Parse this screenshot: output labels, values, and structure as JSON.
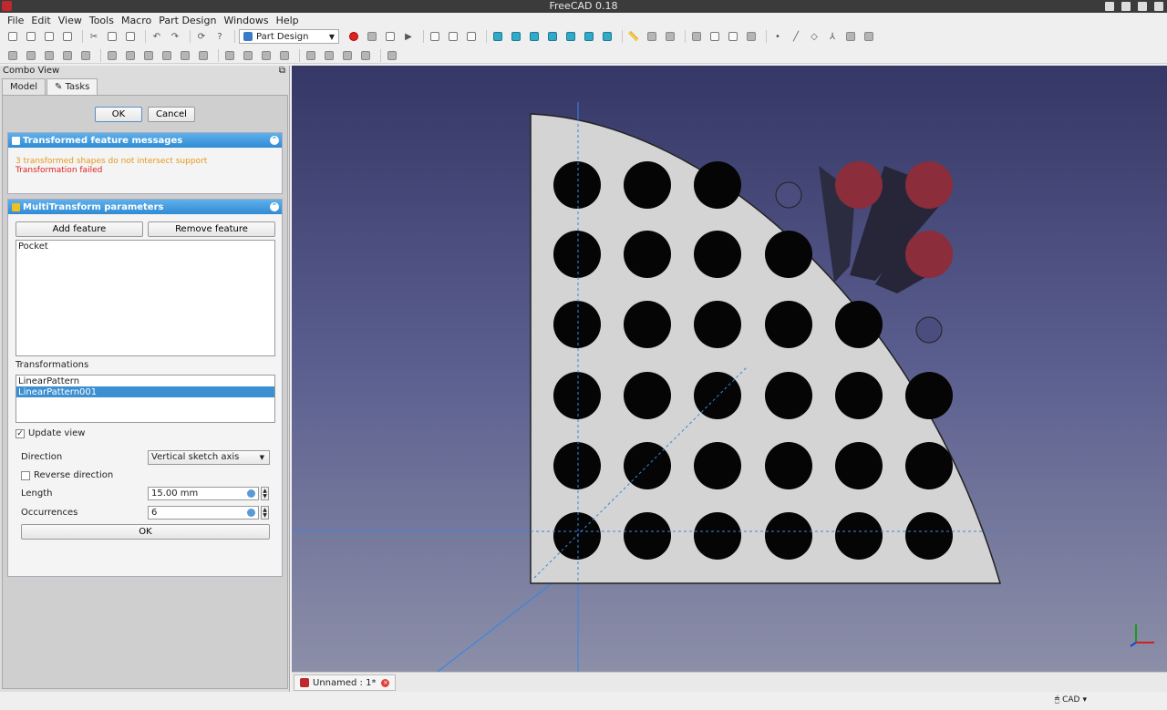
{
  "window": {
    "title": "FreeCAD 0.18"
  },
  "menu": [
    "File",
    "Edit",
    "View",
    "Tools",
    "Macro",
    "Part Design",
    "Windows",
    "Help"
  ],
  "toolbar": {
    "workbench": "Part Design"
  },
  "combo_view": {
    "title": "Combo View",
    "tabs": [
      "Model",
      "Tasks"
    ],
    "ok_label": "OK",
    "cancel_label": "Cancel"
  },
  "messages_panel": {
    "title": "Transformed feature messages",
    "warning": "3 transformed shapes do not intersect support",
    "error": "Transformation failed"
  },
  "multitransform_panel": {
    "title": "MultiTransform parameters",
    "add_feature": "Add feature",
    "remove_feature": "Remove feature",
    "features": [
      "Pocket"
    ],
    "transformations_label": "Transformations",
    "transformations": [
      "LinearPattern",
      "LinearPattern001"
    ],
    "selected_transformation": "LinearPattern001",
    "update_view_label": "Update view",
    "update_view_checked": true,
    "direction_label": "Direction",
    "direction_value": "Vertical sketch axis",
    "reverse_label": "Reverse direction",
    "reverse_checked": false,
    "length_label": "Length",
    "length_value": "15.00 mm",
    "occurrences_label": "Occurrences",
    "occurrences_value": "6",
    "ok_label": "OK"
  },
  "document_tab": {
    "label": "Unnamed : 1*"
  },
  "status": {
    "navigation_style": "CAD"
  },
  "colors": {
    "viewport_top": "#353766",
    "viewport_bottom": "#8c8fa8",
    "accent": "#3c8fd0",
    "error": "#e02020",
    "warning": "#e39a1a",
    "failed_hole": "#8b2d3a"
  }
}
